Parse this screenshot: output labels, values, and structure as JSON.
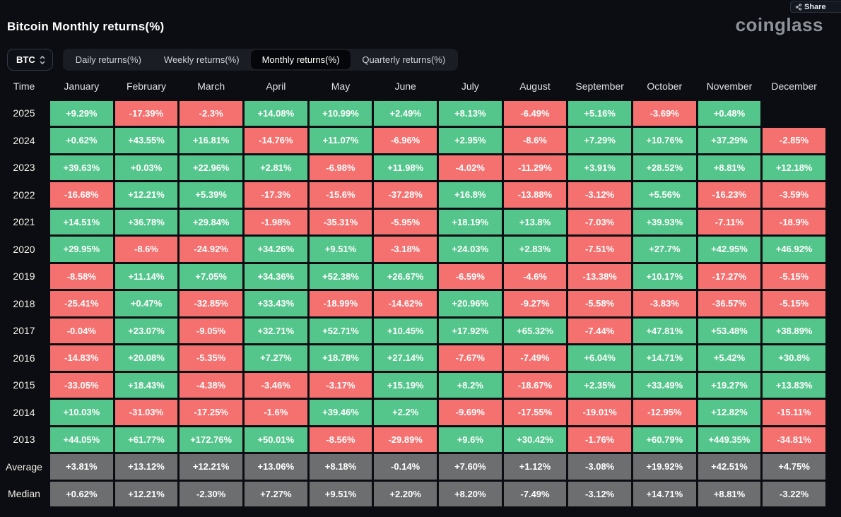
{
  "page": {
    "title": "Bitcoin Monthly returns(%)",
    "logo": "coinglass",
    "share_label": "Share"
  },
  "controls": {
    "coin_selector": "BTC",
    "tabs": [
      {
        "label": "Daily returns(%)",
        "active": false
      },
      {
        "label": "Weekly returns(%)",
        "active": false
      },
      {
        "label": "Monthly returns(%)",
        "active": true
      },
      {
        "label": "Quarterly returns(%)",
        "active": false
      }
    ]
  },
  "colors": {
    "background": "#0b0d12",
    "positive": "#54c68c",
    "negative": "#f47170",
    "neutral": "#6d6e70"
  },
  "chart_data": {
    "type": "heatmap",
    "title": "Bitcoin Monthly returns(%)",
    "columns": [
      "Time",
      "January",
      "February",
      "March",
      "April",
      "May",
      "June",
      "July",
      "August",
      "September",
      "October",
      "November",
      "December"
    ],
    "rows": [
      {
        "label": "2025",
        "summary": false,
        "values": [
          "+9.29%",
          "-17.39%",
          "-2.3%",
          "+14.08%",
          "+10.99%",
          "+2.49%",
          "+8.13%",
          "-6.49%",
          "+5.16%",
          "-3.69%",
          "+0.48%",
          null
        ]
      },
      {
        "label": "2024",
        "summary": false,
        "values": [
          "+0.62%",
          "+43.55%",
          "+16.81%",
          "-14.76%",
          "+11.07%",
          "-6.96%",
          "+2.95%",
          "-8.6%",
          "+7.29%",
          "+10.76%",
          "+37.29%",
          "-2.85%"
        ]
      },
      {
        "label": "2023",
        "summary": false,
        "values": [
          "+39.63%",
          "+0.03%",
          "+22.96%",
          "+2.81%",
          "-6.98%",
          "+11.98%",
          "-4.02%",
          "-11.29%",
          "+3.91%",
          "+28.52%",
          "+8.81%",
          "+12.18%"
        ]
      },
      {
        "label": "2022",
        "summary": false,
        "values": [
          "-16.68%",
          "+12.21%",
          "+5.39%",
          "-17.3%",
          "-15.6%",
          "-37.28%",
          "+16.8%",
          "-13.88%",
          "-3.12%",
          "+5.56%",
          "-16.23%",
          "-3.59%"
        ]
      },
      {
        "label": "2021",
        "summary": false,
        "values": [
          "+14.51%",
          "+36.78%",
          "+29.84%",
          "-1.98%",
          "-35.31%",
          "-5.95%",
          "+18.19%",
          "+13.8%",
          "-7.03%",
          "+39.93%",
          "-7.11%",
          "-18.9%"
        ]
      },
      {
        "label": "2020",
        "summary": false,
        "values": [
          "+29.95%",
          "-8.6%",
          "-24.92%",
          "+34.26%",
          "+9.51%",
          "-3.18%",
          "+24.03%",
          "+2.83%",
          "-7.51%",
          "+27.7%",
          "+42.95%",
          "+46.92%"
        ]
      },
      {
        "label": "2019",
        "summary": false,
        "values": [
          "-8.58%",
          "+11.14%",
          "+7.05%",
          "+34.36%",
          "+52.38%",
          "+26.67%",
          "-6.59%",
          "-4.6%",
          "-13.38%",
          "+10.17%",
          "-17.27%",
          "-5.15%"
        ]
      },
      {
        "label": "2018",
        "summary": false,
        "values": [
          "-25.41%",
          "+0.47%",
          "-32.85%",
          "+33.43%",
          "-18.99%",
          "-14.62%",
          "+20.96%",
          "-9.27%",
          "-5.58%",
          "-3.83%",
          "-36.57%",
          "-5.15%"
        ]
      },
      {
        "label": "2017",
        "summary": false,
        "values": [
          "-0.04%",
          "+23.07%",
          "-9.05%",
          "+32.71%",
          "+52.71%",
          "+10.45%",
          "+17.92%",
          "+65.32%",
          "-7.44%",
          "+47.81%",
          "+53.48%",
          "+38.89%"
        ]
      },
      {
        "label": "2016",
        "summary": false,
        "values": [
          "-14.83%",
          "+20.08%",
          "-5.35%",
          "+7.27%",
          "+18.78%",
          "+27.14%",
          "-7.67%",
          "-7.49%",
          "+6.04%",
          "+14.71%",
          "+5.42%",
          "+30.8%"
        ]
      },
      {
        "label": "2015",
        "summary": false,
        "values": [
          "-33.05%",
          "+18.43%",
          "-4.38%",
          "-3.46%",
          "-3.17%",
          "+15.19%",
          "+8.2%",
          "-18.67%",
          "+2.35%",
          "+33.49%",
          "+19.27%",
          "+13.83%"
        ]
      },
      {
        "label": "2014",
        "summary": false,
        "values": [
          "+10.03%",
          "-31.03%",
          "-17.25%",
          "-1.6%",
          "+39.46%",
          "+2.2%",
          "-9.69%",
          "-17.55%",
          "-19.01%",
          "-12.95%",
          "+12.82%",
          "-15.11%"
        ]
      },
      {
        "label": "2013",
        "summary": false,
        "values": [
          "+44.05%",
          "+61.77%",
          "+172.76%",
          "+50.01%",
          "-8.56%",
          "-29.89%",
          "+9.6%",
          "+30.42%",
          "-1.76%",
          "+60.79%",
          "+449.35%",
          "-34.81%"
        ]
      },
      {
        "label": "Average",
        "summary": true,
        "values": [
          "+3.81%",
          "+13.12%",
          "+12.21%",
          "+13.06%",
          "+8.18%",
          "-0.14%",
          "+7.60%",
          "+1.12%",
          "-3.08%",
          "+19.92%",
          "+42.51%",
          "+4.75%"
        ]
      },
      {
        "label": "Median",
        "summary": true,
        "values": [
          "+0.62%",
          "+12.21%",
          "-2.30%",
          "+7.27%",
          "+9.51%",
          "+2.20%",
          "+8.20%",
          "-7.49%",
          "-3.12%",
          "+14.71%",
          "+8.81%",
          "-3.22%"
        ]
      }
    ]
  }
}
